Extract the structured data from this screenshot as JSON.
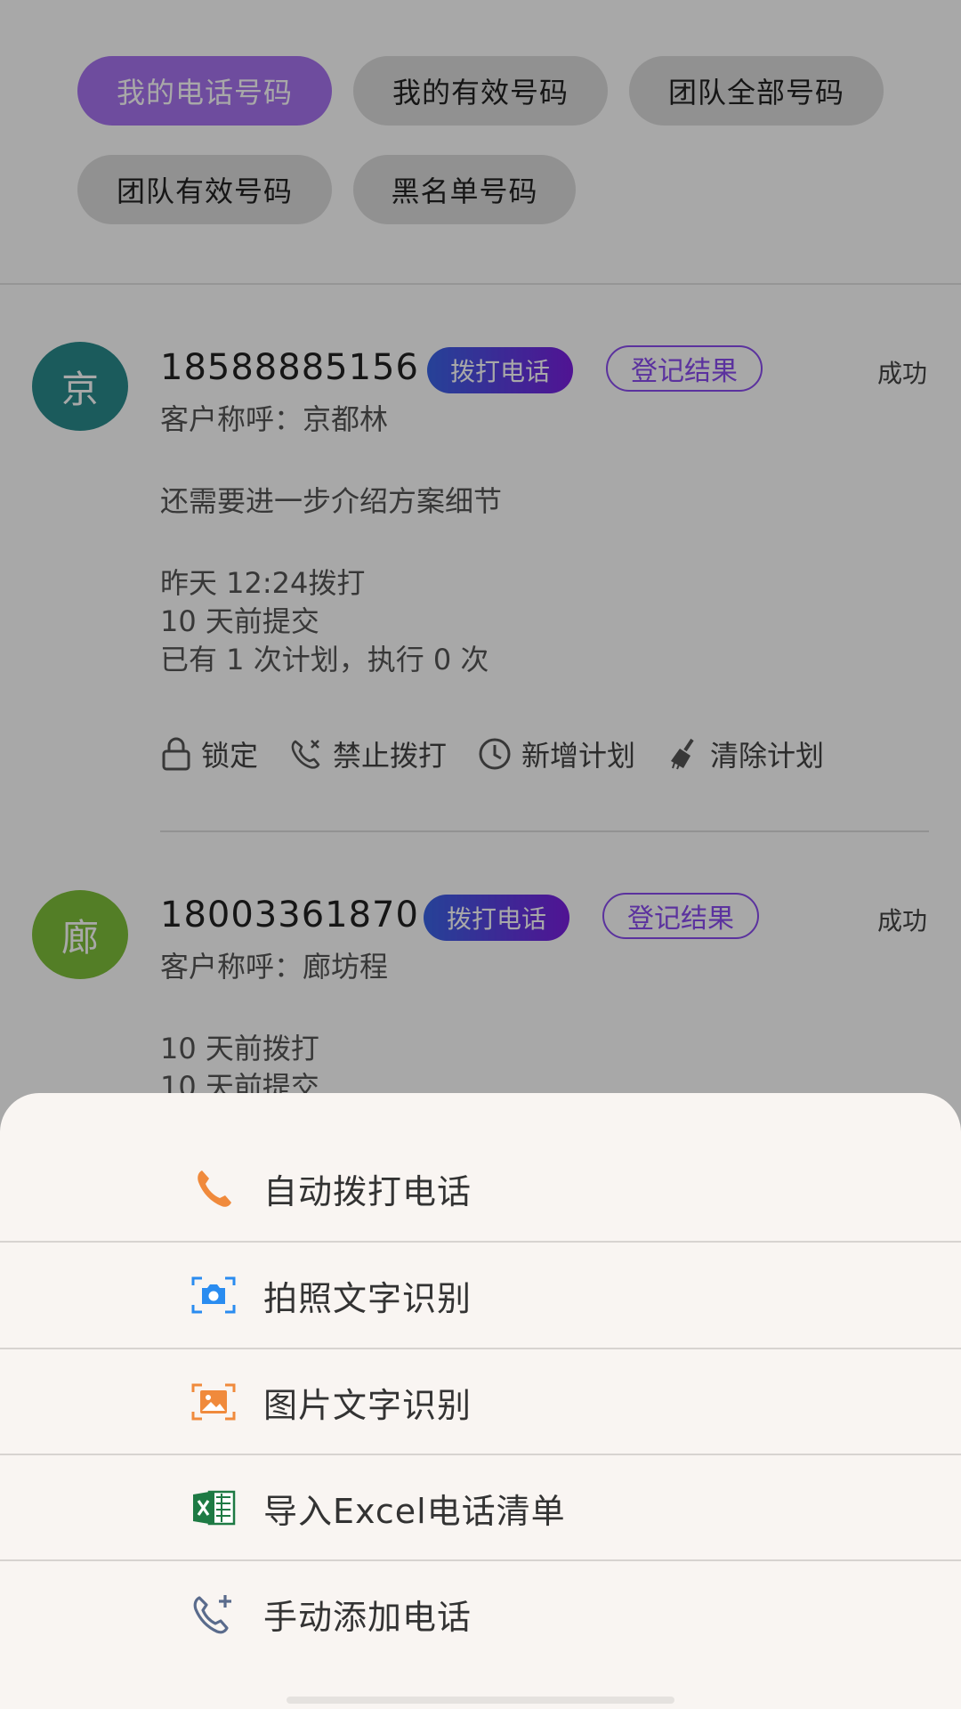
{
  "filters": [
    {
      "label": "我的电话号码",
      "active": true
    },
    {
      "label": "我的有效号码",
      "active": false
    },
    {
      "label": "团队全部号码",
      "active": false
    },
    {
      "label": "团队有效号码",
      "active": false
    },
    {
      "label": "黑名单号码",
      "active": false
    }
  ],
  "records": [
    {
      "avatar_char": "京",
      "avatar_color": "#2a8a8c",
      "phone": "18588885156",
      "dial_label": "拨打电话",
      "register_label": "登记结果",
      "status": "成功",
      "customer_label": "客户称呼：京都林",
      "note": "还需要进一步介绍方案细节",
      "call_time": "昨天  12:24拨打",
      "submit_time": "10  天前提交",
      "plan_info": "已有  1  次计划，执行  0  次",
      "actions": {
        "lock": "锁定",
        "ban": "禁止拨打",
        "add_plan": "新增计划",
        "clear_plan": "清除计划"
      }
    },
    {
      "avatar_char": "廊",
      "avatar_color": "#7fbf3a",
      "phone": "18003361870",
      "dial_label": "拨打电话",
      "register_label": "登记结果",
      "status": "成功",
      "customer_label": "客户称呼：廊坊程",
      "call_time": "10  天前拨打",
      "submit_time": "10  天前提交"
    }
  ],
  "sheet": {
    "items": [
      {
        "label": "自动拨打电话",
        "icon": "phone-icon"
      },
      {
        "label": "拍照文字识别",
        "icon": "camera-scan-icon"
      },
      {
        "label": "图片文字识别",
        "icon": "image-scan-icon"
      },
      {
        "label": "导入Excel电话清单",
        "icon": "excel-icon"
      },
      {
        "label": "手动添加电话",
        "icon": "phone-add-icon"
      }
    ]
  },
  "colors": {
    "accent": "#a874f0",
    "dial_gradient_start": "#3a64e6",
    "dial_gradient_end": "#7a1ee0",
    "phone_icon": "#f08a3c",
    "camera_icon": "#2a8cf0",
    "image_icon": "#f08a3c",
    "excel_icon": "#1e7a44",
    "phone_add_icon": "#5a6b8c"
  }
}
